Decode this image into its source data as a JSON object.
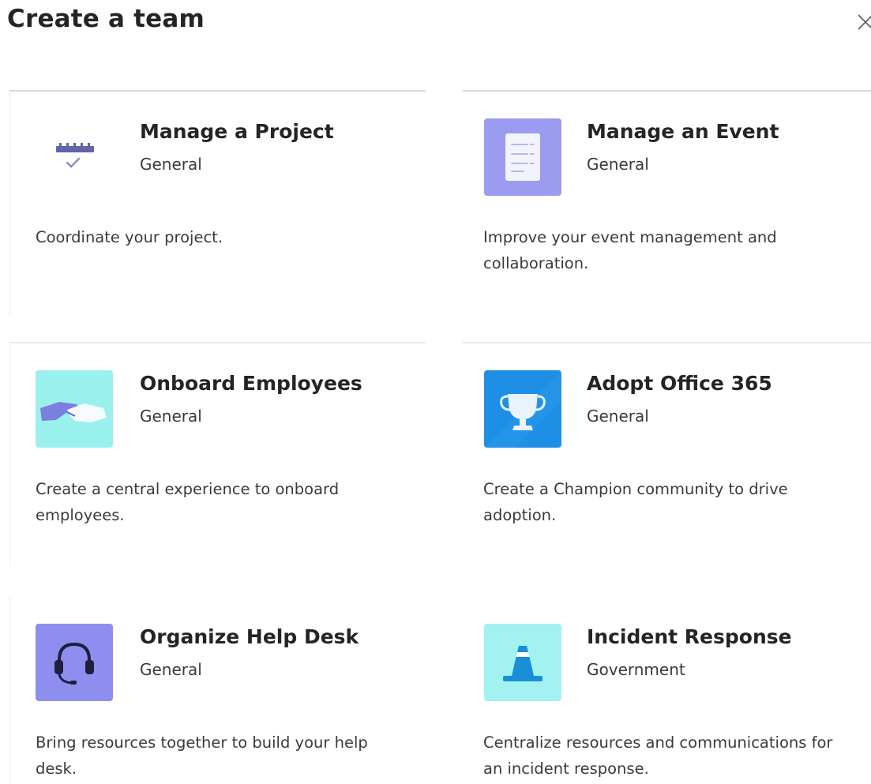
{
  "dialog": {
    "title": "Create a team",
    "close_icon": "close-icon"
  },
  "templates": [
    {
      "title": "Manage a Project",
      "category": "General",
      "description": "Coordinate your project.",
      "icon": "project-calendar-icon",
      "icon_color": "#ffffff"
    },
    {
      "title": "Manage an Event",
      "category": "General",
      "description": "Improve your event management and collaboration.",
      "icon": "event-checklist-icon",
      "icon_color": "#9b9bf0"
    },
    {
      "title": "Onboard Employees",
      "category": "General",
      "description": "Create a central experience to onboard employees.",
      "icon": "handshake-icon",
      "icon_color": "#9af0ec"
    },
    {
      "title": "Adopt Office 365",
      "category": "General",
      "description": "Create a Champion community to drive adoption.",
      "icon": "trophy-icon",
      "icon_color": "#1f8fe6"
    },
    {
      "title": "Organize Help Desk",
      "category": "General",
      "description": "Bring resources together to build your help desk.",
      "icon": "headset-icon",
      "icon_color": "#8e8ef0"
    },
    {
      "title": "Incident Response",
      "category": "Government",
      "description": "Centralize resources and communications for an incident response.",
      "icon": "traffic-cone-icon",
      "icon_color": "#a3f2f2"
    }
  ]
}
